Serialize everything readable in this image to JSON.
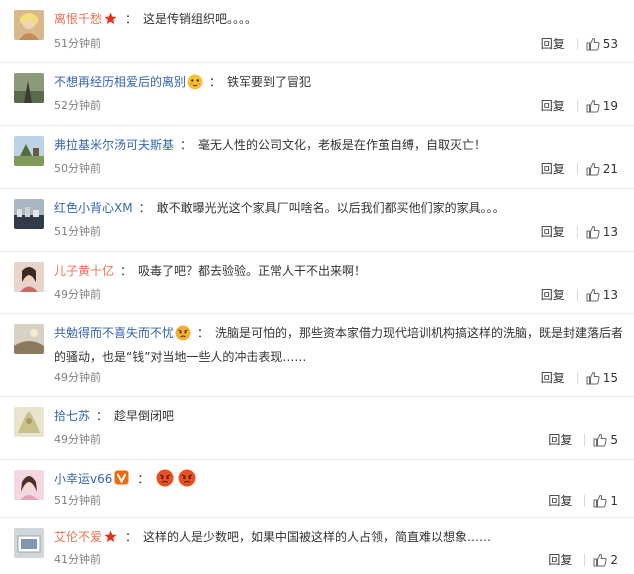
{
  "colon": "：",
  "reply_label": "回复",
  "icons": {
    "like": "thumbs-up-icon",
    "star_badge": "star-badge-icon",
    "v_badge": "vip-badge-icon",
    "emoji_smile": "blush-emoji-icon",
    "emoji_angry": "angry-emoji-icon"
  },
  "colors": {
    "username_orange": "#eb7350",
    "username_blue": "#3565b1",
    "meta_gray": "#808080"
  },
  "comments": [
    {
      "username": "离恨千愁",
      "text": "这是传销组织吧。。。。",
      "time": "51分钟前",
      "likes": "53"
    },
    {
      "username": "不想再经历相爱后的离别",
      "text": "铁军要到了冒犯",
      "time": "52分钟前",
      "likes": "19"
    },
    {
      "username": "弗拉基米尔汤可夫斯基",
      "text": "毫无人性的公司文化，老板是在作茧自缚，自取灭亡！",
      "time": "50分钟前",
      "likes": "21"
    },
    {
      "username": "红色小背心XM",
      "text": "敢不敢曝光光这个家具厂叫啥名。以后我们都买他们家的家具。。。",
      "time": "51分钟前",
      "likes": "13"
    },
    {
      "username": "儿子黄十亿",
      "text": "吸毒了吧？都去验验。正常人干不出来啊！",
      "time": "49分钟前",
      "likes": "13"
    },
    {
      "username": "共勉得而不喜失而不忧",
      "text": "洗脑是可怕的，那些资本家借力现代培训机构搞这样的洗脑，既是封建落后者的骚动，也是“钱”对当地一些人的冲击表现……",
      "time": "49分钟前",
      "likes": "15"
    },
    {
      "username": "拾七苏",
      "text": "趁早倒闭吧",
      "time": "49分钟前",
      "likes": "5"
    },
    {
      "username": "小幸运v66",
      "text": "",
      "time": "51分钟前",
      "likes": "1"
    },
    {
      "username": "艾伦不爱",
      "text": "这样的人是少数吧，如果中国被这样的人占领，简直难以想象……",
      "time": "41分钟前",
      "likes": "2"
    }
  ]
}
